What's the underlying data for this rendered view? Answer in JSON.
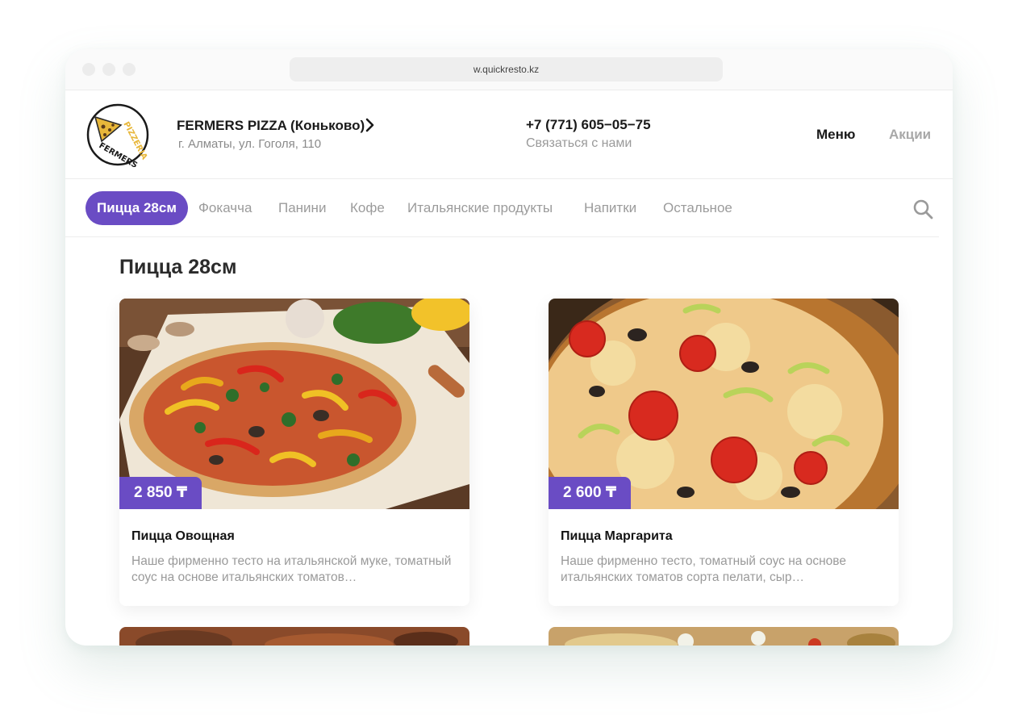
{
  "browser": {
    "url": "w.quickresto.kz"
  },
  "header": {
    "restaurant_name": "FERMERS PIZZA (Коньково)",
    "address": "г. Алматы, ул. Гоголя, 110",
    "phone": "+7 (771) 605−05−75",
    "contact_label": "Связаться с нами",
    "nav": {
      "menu": "Меню",
      "promotions": "Акции"
    },
    "logo_text": [
      "PIZZERIA",
      "FERMERS"
    ]
  },
  "categories": {
    "items": [
      {
        "label": "Пицца 28см",
        "active": true
      },
      {
        "label": "Фокачча",
        "active": false
      },
      {
        "label": "Панини",
        "active": false
      },
      {
        "label": "Кофе",
        "active": false
      },
      {
        "label": "Итальянские продукты",
        "active": false
      },
      {
        "label": "Напитки",
        "active": false
      },
      {
        "label": "Остальное",
        "active": false
      }
    ]
  },
  "section": {
    "title": "Пицца 28см"
  },
  "products": [
    {
      "name": "Пицца Овощная",
      "price": "2 850 ₸",
      "description": "Наше фирменно тесто на итальянской муке, томатный соус на основе итальянских томатов…"
    },
    {
      "name": "Пицца Маргарита",
      "price": "2 600 ₸",
      "description": "Наше фирменно тесто, томатный соус на основе итальянских томатов сорта пелати, сыр…"
    }
  ],
  "colors": {
    "accent": "#6a4cc4",
    "muted_text": "#9a9a9a",
    "dark_text": "#1a1a1a"
  }
}
